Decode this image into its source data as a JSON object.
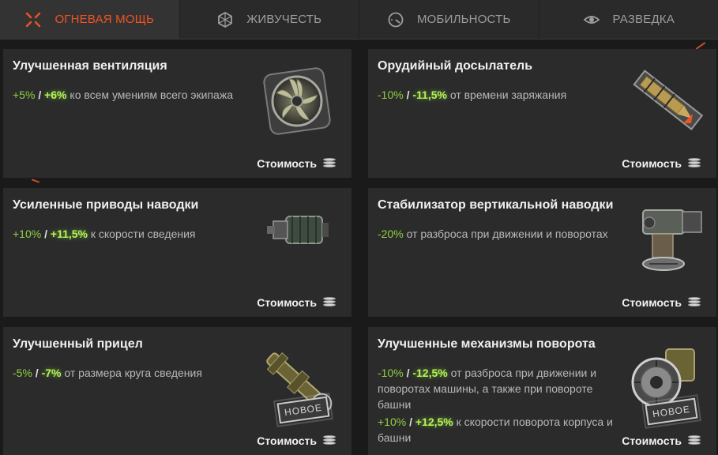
{
  "tabs": [
    {
      "label": "ОГНЕВАЯ МОЩЬ",
      "icon": "crosshair-icon",
      "active": true
    },
    {
      "label": "ЖИВУЧЕСТЬ",
      "icon": "armor-hex-icon",
      "active": false
    },
    {
      "label": "МОБИЛЬНОСТЬ",
      "icon": "speedometer-icon",
      "active": false
    },
    {
      "label": "РАЗВЕДКА",
      "icon": "eye-icon",
      "active": false
    }
  ],
  "cost_label": "Стоимость",
  "new_label": "НОВОЕ",
  "separator": "/",
  "cards": [
    {
      "title": "Улучшенная вентиляция",
      "lines": [
        {
          "v1": "+5%",
          "v2": "+6%",
          "text": "ко всем умениям всего экипажа"
        }
      ],
      "icon": "fan-icon",
      "new": false
    },
    {
      "title": "Орудийный досылатель",
      "lines": [
        {
          "v1": "-10%",
          "v2": "-11,5%",
          "text": "от времени заряжания"
        }
      ],
      "icon": "rammer-icon",
      "new": false
    },
    {
      "title": "Усиленные приводы наводки",
      "lines": [
        {
          "v1": "+10%",
          "v2": "+11,5%",
          "text": "к скорости сведения"
        }
      ],
      "icon": "motor-icon",
      "new": false
    },
    {
      "title": "Стабилизатор вертикальной наводки",
      "lines": [
        {
          "v1": "-20%",
          "v2": "",
          "text": "от разброса при движении и поворотах"
        }
      ],
      "icon": "stabilizer-icon",
      "new": false
    },
    {
      "title": "Улучшенный прицел",
      "lines": [
        {
          "v1": "-5%",
          "v2": "-7%",
          "text": "от размера круга сведения"
        }
      ],
      "icon": "gunsight-icon",
      "new": true
    },
    {
      "title": "Улучшенные механизмы поворота",
      "lines": [
        {
          "v1": "-10%",
          "v2": "-12,5%",
          "text": "от разброса при движении и поворотах машины, а также при повороте башни"
        },
        {
          "v1": "+10%",
          "v2": "+12,5%",
          "text": "к скорости поворота корпуса и башни"
        }
      ],
      "icon": "turret-ring-icon",
      "new": true
    }
  ],
  "colors": {
    "accent": "#f25322",
    "bonus": "#8fd140",
    "bonus_bright": "#b6f35a",
    "card_bg": "#2b2b2c"
  }
}
